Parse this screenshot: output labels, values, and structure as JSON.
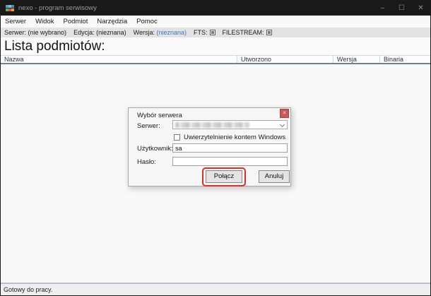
{
  "window": {
    "title": "nexo - program serwisowy",
    "minimize_glyph": "–",
    "maximize_glyph": "☐",
    "close_glyph": "✕"
  },
  "menu": {
    "items": [
      "Serwer",
      "Widok",
      "Podmiot",
      "Narzędzia",
      "Pomoc"
    ]
  },
  "toolbar": {
    "server_label": "Serwer:",
    "server_value": "(nie wybrano)",
    "edition_label": "Edycja:",
    "edition_value": "(nieznana)",
    "version_label": "Wersja:",
    "version_value": "(nieznana)",
    "version_value_color": "#3b78c8",
    "fts_label": "FTS:",
    "filestream_label": "FILESTREAM:"
  },
  "main": {
    "heading": "Lista podmiotów:",
    "table": {
      "columns": [
        {
          "label": "Nazwa"
        },
        {
          "label": "Utworzono"
        },
        {
          "label": "Wersja"
        },
        {
          "label": "Binaria"
        }
      ],
      "rows": []
    }
  },
  "dialog": {
    "title": "Wybór serwera",
    "close_glyph": "✕",
    "server_label": "Serwer:",
    "server_value": "",
    "checkbox_label": "Uwierzytelnienie kontem Windows",
    "checkbox_checked": false,
    "username_label": "Użytkownik:",
    "username_value": "sa",
    "password_label": "Hasło:",
    "password_value": "",
    "connect_label": "Połącz",
    "cancel_label": "Anuluj",
    "highlight_color": "#d93025"
  },
  "statusbar": {
    "text": "Gotowy do pracy."
  }
}
